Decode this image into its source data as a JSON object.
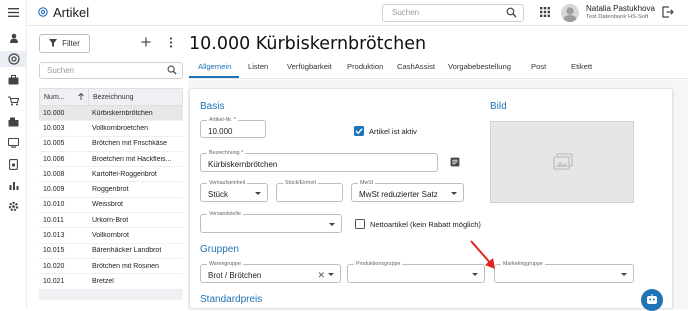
{
  "app": {
    "title": "Artikel",
    "search_placeholder": "Suchen",
    "user_name": "Natalia Pastukhova",
    "user_sub": "Test Datenbank HS-Soft",
    "accent": "#1f73b7"
  },
  "rail": {
    "icons": [
      "menu-icon",
      "person-icon",
      "article-icon",
      "briefcase-icon",
      "cart-icon",
      "register-icon",
      "monitor-icon",
      "phone-icon",
      "calendar-icon",
      "chart-icon",
      "gear-icon"
    ]
  },
  "list": {
    "filter_label": "Filter",
    "search_placeholder": "Suchen",
    "col_num": "Num...",
    "col_name": "Bezeichnung",
    "rows": [
      {
        "num": "10.000",
        "name": "Kürbiskernbrötchen"
      },
      {
        "num": "10.003",
        "name": "Vollkornbroetchen"
      },
      {
        "num": "10.005",
        "name": "Brötchen mit Frischkäse"
      },
      {
        "num": "10.006",
        "name": "Broetchen mit Hackfleis..."
      },
      {
        "num": "10.008",
        "name": "Kartoffel-Roggenbrot"
      },
      {
        "num": "10.009",
        "name": "Roggenbrot"
      },
      {
        "num": "10.010",
        "name": "Weissbrot"
      },
      {
        "num": "10.011",
        "name": "Urkorn-Brot"
      },
      {
        "num": "10.013",
        "name": "Vollkornbrot"
      },
      {
        "num": "10.015",
        "name": "Bärenhäcker Landbrot"
      },
      {
        "num": "10.020",
        "name": "Brötchen mit Rosinen"
      },
      {
        "num": "10.021",
        "name": "Bretzel"
      }
    ]
  },
  "detail": {
    "title": "10.000 Kürbiskernbrötchen",
    "tabs": [
      "Allgemein",
      "Listen",
      "Verfügbarkeit",
      "Produktion",
      "CashAssist",
      "Vorgabebestellung",
      "Post",
      "Etikett"
    ],
    "sections": {
      "basis": "Basis",
      "bild": "Bild",
      "gruppen": "Gruppen",
      "standardpreis": "Standardpreis"
    },
    "fields": {
      "artikel_nr_label": "Artikel-Nr. *",
      "artikel_nr_value": "10.000",
      "aktiv_label": "Artikel ist aktiv",
      "bezeichnung_label": "Bezeichnung *",
      "bezeichnung_value": "Kürbiskernbrötchen",
      "verkaufseinheit_label": "Verkaufseinheit",
      "verkaufseinheit_value": "Stück",
      "stueck_label": "Stück/Einheit",
      "mwst_label": "MwSt",
      "mwst_value": "MwSt reduzierter Satz",
      "versandstelle_label": "Versandstelle",
      "netto_label": "Nettoartikel (kein Rabatt möglich)",
      "warengruppe_label": "Warengruppe",
      "warengruppe_value": "Brot / Brötchen",
      "produktionsgruppe_label": "Produktionsgruppe",
      "marketinggruppe_label": "Marketinggruppe"
    }
  }
}
